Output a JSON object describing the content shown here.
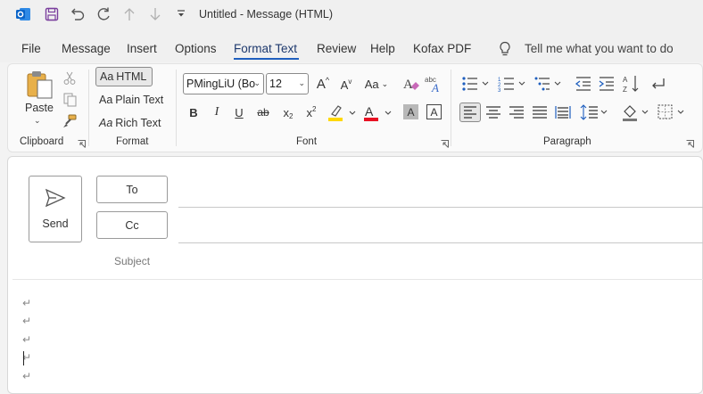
{
  "window": {
    "title": "Untitled  -  Message (HTML)"
  },
  "quick_access": [
    {
      "name": "outlook-logo-icon"
    },
    {
      "name": "save-icon"
    },
    {
      "name": "undo-icon"
    },
    {
      "name": "redo-icon"
    },
    {
      "name": "previous-item-icon"
    },
    {
      "name": "next-item-icon"
    },
    {
      "name": "customize-toolbar-icon"
    }
  ],
  "menu": {
    "tabs": [
      "File",
      "Message",
      "Insert",
      "Options",
      "Format Text",
      "Review",
      "Help",
      "Kofax PDF"
    ],
    "active": "Format Text",
    "tell_me": "Tell me what you want to do"
  },
  "ribbon": {
    "clipboard": {
      "paste_label": "Paste",
      "group_label": "Clipboard"
    },
    "format": {
      "items": [
        {
          "prefix": "Aa",
          "label": "HTML"
        },
        {
          "prefix": "Aa",
          "label": "Plain Text"
        },
        {
          "prefix": "Aa",
          "label": "Rich Text"
        }
      ],
      "group_label": "Format"
    },
    "font": {
      "font_name": "PMingLiU (Bo",
      "font_size": "12",
      "grow_label": "A",
      "shrink_label": "A",
      "case_label": "Aa",
      "bold": "B",
      "italic": "I",
      "underline": "U",
      "strike": "ab",
      "subscript": "x",
      "superscript": "x",
      "highlight_color": "#ffd800",
      "font_color": "#e81123",
      "group_label": "Font"
    },
    "paragraph": {
      "group_label": "Paragraph"
    }
  },
  "compose": {
    "send_label": "Send",
    "to_label": "To",
    "cc_label": "Cc",
    "subject_label": "Subject",
    "paragraph_marks": [
      "↵",
      "↵",
      "↵",
      "↵",
      "↵"
    ]
  },
  "colors": {
    "accent": "#1f5fbf",
    "outlook_blue": "#0a64c8",
    "save_purple": "#7a3e9d"
  }
}
